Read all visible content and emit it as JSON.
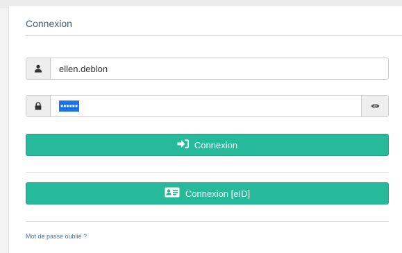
{
  "login": {
    "title": "Connexion",
    "username": {
      "value": "ellen.deblon",
      "icon": "user-icon"
    },
    "password": {
      "masked_value": "••••••",
      "icon": "lock-icon",
      "toggle_icon": "eye-icon"
    },
    "login_button": {
      "label": "Connexion",
      "icon": "sign-in-icon"
    },
    "eid_button": {
      "label": "Connexion [eID]",
      "icon": "id-card-icon"
    },
    "forgot_link": "Mot de passe oublié ?"
  },
  "colors": {
    "accent": "#26b99a",
    "selection": "#1a73e8",
    "title_text": "#4a5a73",
    "link": "#337ab7"
  }
}
